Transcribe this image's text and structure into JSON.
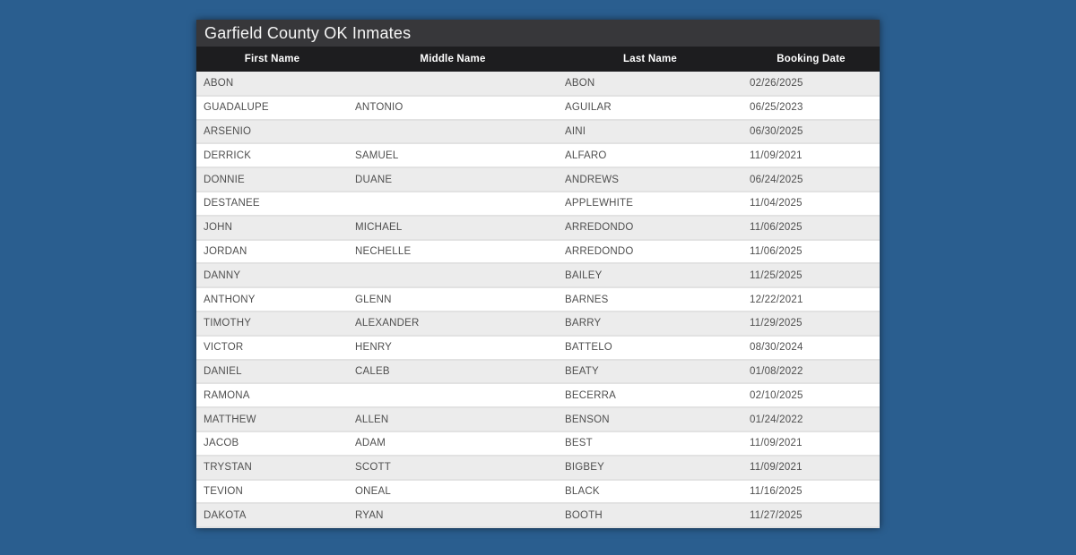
{
  "page": {
    "background_color": "#2a5e8f"
  },
  "table": {
    "title": "Garfield County OK Inmates",
    "title_bar_color": "#37373a",
    "header_bar_color": "#1d1d1f",
    "row_stripe_color": "#ececec",
    "row_color": "#ffffff",
    "columns": [
      "First Name",
      "Middle Name",
      "Last Name",
      "Booking Date"
    ],
    "rows": [
      [
        "ABON",
        "",
        "ABON",
        "02/26/2025"
      ],
      [
        "GUADALUPE",
        "ANTONIO",
        "AGUILAR",
        "06/25/2023"
      ],
      [
        "ARSENIO",
        "",
        "AINI",
        "06/30/2025"
      ],
      [
        "DERRICK",
        "SAMUEL",
        "ALFARO",
        "11/09/2021"
      ],
      [
        "DONNIE",
        "DUANE",
        "ANDREWS",
        "06/24/2025"
      ],
      [
        "DESTANEE",
        "",
        "APPLEWHITE",
        "11/04/2025"
      ],
      [
        "JOHN",
        "MICHAEL",
        "ARREDONDO",
        "11/06/2025"
      ],
      [
        "JORDAN",
        "NECHELLE",
        "ARREDONDO",
        "11/06/2025"
      ],
      [
        "DANNY",
        "",
        "BAILEY",
        "11/25/2025"
      ],
      [
        "ANTHONY",
        "GLENN",
        "BARNES",
        "12/22/2021"
      ],
      [
        "TIMOTHY",
        "ALEXANDER",
        "BARRY",
        "11/29/2025"
      ],
      [
        "VICTOR",
        "HENRY",
        "BATTELO",
        "08/30/2024"
      ],
      [
        "DANIEL",
        "CALEB",
        "BEATY",
        "01/08/2022"
      ],
      [
        "RAMONA",
        "",
        "BECERRA",
        "02/10/2025"
      ],
      [
        "MATTHEW",
        "ALLEN",
        "BENSON",
        "01/24/2022"
      ],
      [
        "JACOB",
        "ADAM",
        "BEST",
        "11/09/2021"
      ],
      [
        "TRYSTAN",
        "SCOTT",
        "BIGBEY",
        "11/09/2021"
      ],
      [
        "TEVION",
        "ONEAL",
        "BLACK",
        "11/16/2025"
      ],
      [
        "DAKOTA",
        "RYAN",
        "BOOTH",
        "11/27/2025"
      ]
    ]
  }
}
